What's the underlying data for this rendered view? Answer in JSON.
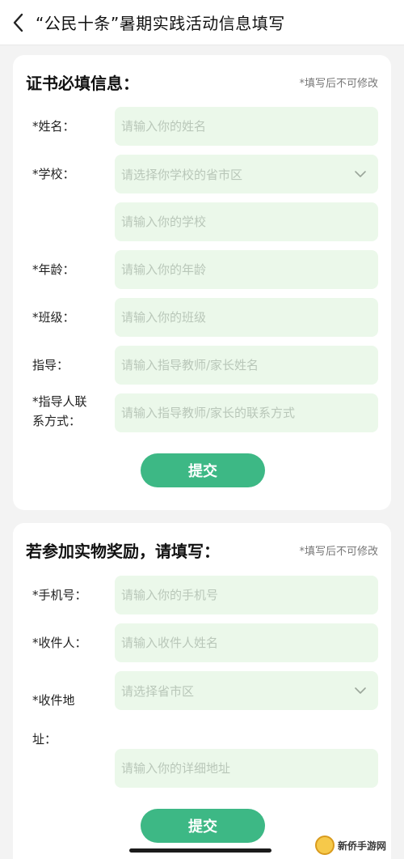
{
  "nav": {
    "title": "“公民十条”暑期实践活动信息填写"
  },
  "certificate_section": {
    "title": "证书必填信息：",
    "note": "*填写后不可修改",
    "fields": {
      "name": {
        "label": "*姓名：",
        "placeholder": "请输入你的姓名"
      },
      "school": {
        "label": "*学校：",
        "placeholder": "请选择你学校的省市区"
      },
      "school_name": {
        "placeholder": "请输入你的学校"
      },
      "age": {
        "label": "*年龄：",
        "placeholder": "请输入你的年龄"
      },
      "class": {
        "label": "*班级：",
        "placeholder": "请输入你的班级"
      },
      "guide": {
        "label": "指导：",
        "placeholder": "请输入指导教师/家长姓名"
      },
      "guide_contact": {
        "label_line1": "*指导人联",
        "label_line2": "系方式：",
        "placeholder": "请输入指导教师/家长的联系方式"
      }
    },
    "submit_label": "提交"
  },
  "reward_section": {
    "title": "若参加实物奖励，请填写：",
    "note": "*填写后不可修改",
    "fields": {
      "phone": {
        "label": "*手机号：",
        "placeholder": "请输入你的手机号"
      },
      "recipient": {
        "label": "*收件人：",
        "placeholder": "请输入收件人姓名"
      },
      "address_region": {
        "label_line1": "*收件地",
        "label_line2": "址：",
        "placeholder": "请选择省市区"
      },
      "address_detail": {
        "placeholder": "请输入你的详细地址"
      }
    },
    "submit_label": "提交"
  },
  "watermark": {
    "text": "新侨手游网"
  },
  "colors": {
    "accent": "#3db885",
    "field_bg": "#ebf8ea",
    "page_bg": "#f3f3f3"
  }
}
